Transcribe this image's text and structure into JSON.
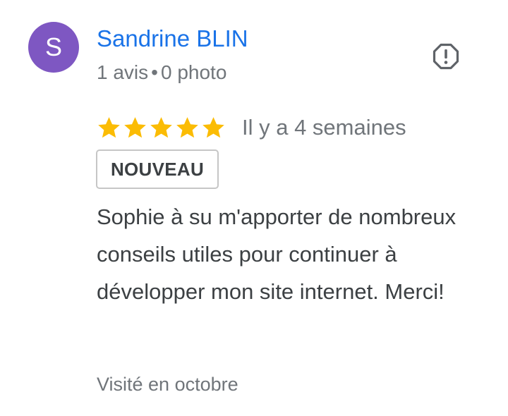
{
  "author": {
    "avatar_letter": "S",
    "avatar_color": "#7e57c2",
    "name": "Sandrine BLIN",
    "name_color": "#1a73e8",
    "review_count": "1 avis",
    "separator": "•",
    "photo_count": "0 photo"
  },
  "report": {
    "icon": "report-icon",
    "color": "#5f6368"
  },
  "rating": {
    "stars": 5,
    "max": 5,
    "star_color": "#fbbc04"
  },
  "date": "Il y a 4 semaines",
  "badge": "NOUVEAU",
  "review_text": "Sophie à su m'apporter de nombreux conseils utiles pour continuer à développer mon site internet. Merci!",
  "visited": "Visité en octobre"
}
